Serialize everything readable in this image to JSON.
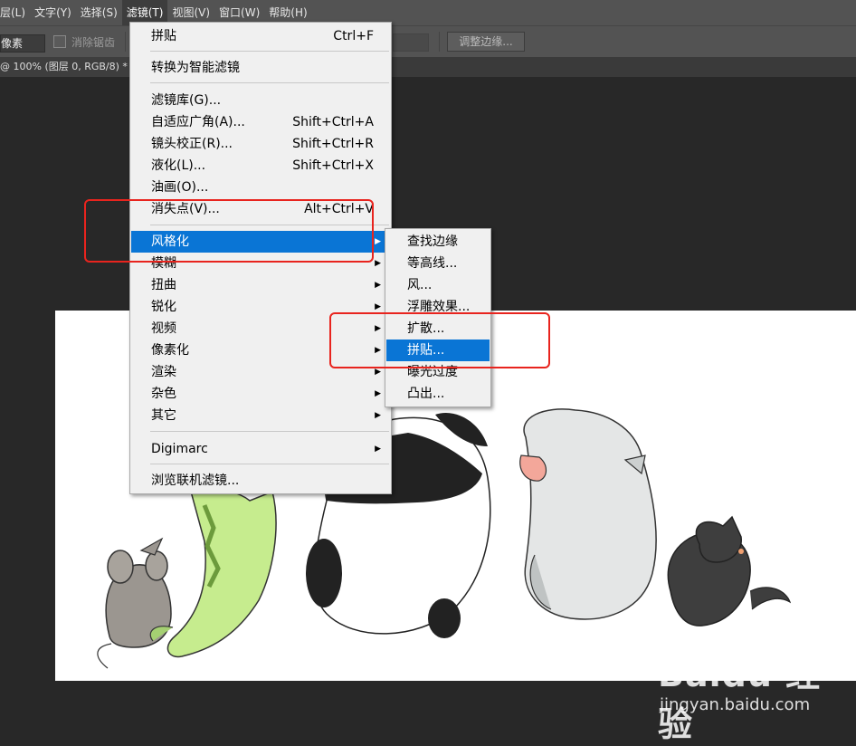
{
  "menubar": {
    "items": [
      "层(L)",
      "文字(Y)",
      "选择(S)",
      "滤镜(T)",
      "视图(V)",
      "窗口(W)",
      "帮助(H)"
    ]
  },
  "options": {
    "mode_value": "像素",
    "antialias_label": "消除锯齿",
    "refine_edge_button": "调整边缘..."
  },
  "document_tab": {
    "title": "@ 100% (图层 0, RGB/8) *"
  },
  "filter_menu": {
    "items": [
      {
        "label": "拼贴",
        "shortcut": "Ctrl+F"
      },
      {
        "label": "转换为智能滤镜"
      },
      {
        "label": "滤镜库(G)..."
      },
      {
        "label": "自适应广角(A)...",
        "shortcut": "Shift+Ctrl+A"
      },
      {
        "label": "镜头校正(R)...",
        "shortcut": "Shift+Ctrl+R"
      },
      {
        "label": "液化(L)...",
        "shortcut": "Shift+Ctrl+X"
      },
      {
        "label": "油画(O)..."
      },
      {
        "label": "消失点(V)...",
        "shortcut": "Alt+Ctrl+V"
      },
      {
        "label": "风格化",
        "highlighted": true
      },
      {
        "label": "模糊"
      },
      {
        "label": "扭曲"
      },
      {
        "label": "锐化"
      },
      {
        "label": "视频"
      },
      {
        "label": "像素化"
      },
      {
        "label": "渲染"
      },
      {
        "label": "杂色"
      },
      {
        "label": "其它"
      },
      {
        "label": "Digimarc"
      },
      {
        "label": "浏览联机滤镜..."
      }
    ]
  },
  "stylize_submenu": {
    "items": [
      {
        "label": "查找边缘"
      },
      {
        "label": "等高线..."
      },
      {
        "label": "风..."
      },
      {
        "label": "浮雕效果..."
      },
      {
        "label": "扩散..."
      },
      {
        "label": "拼贴...",
        "highlighted": true
      },
      {
        "label": "曝光过度"
      },
      {
        "label": "凸出..."
      }
    ]
  },
  "watermark": {
    "brand": "Baidu 经验",
    "site": "jingyan.baidu.com"
  },
  "colors": {
    "highlight": "#0a75d5",
    "annotation_red": "#e8241e",
    "workspace": "#282828",
    "toolbar": "#535353"
  }
}
